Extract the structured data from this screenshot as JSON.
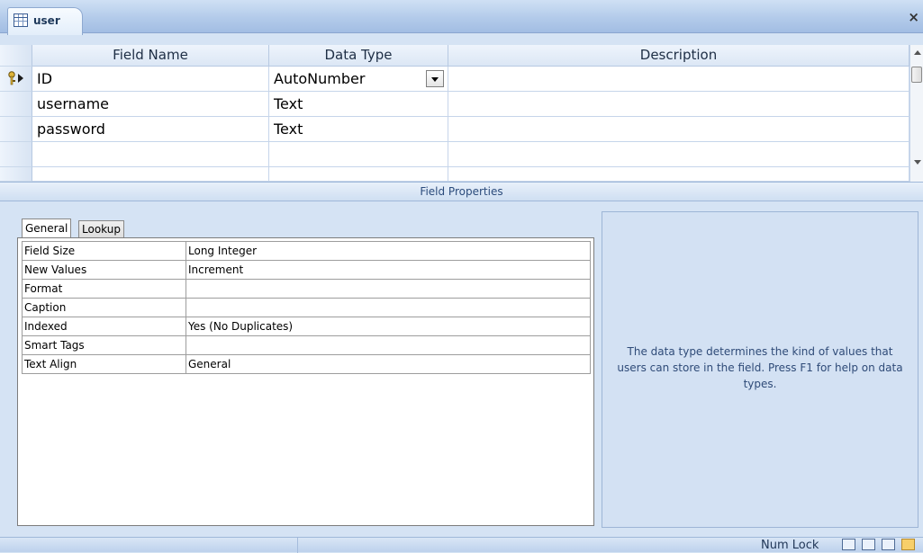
{
  "document_tab": {
    "label": "user",
    "close_glyph": "×",
    "icon": "table-icon"
  },
  "field_grid": {
    "headers": [
      "Field Name",
      "Data Type",
      "Description"
    ],
    "rows": [
      {
        "field_name": "ID",
        "data_type": "AutoNumber",
        "description": "",
        "primary_key": true,
        "selected": true
      },
      {
        "field_name": "username",
        "data_type": "Text",
        "description": ""
      },
      {
        "field_name": "password",
        "data_type": "Text",
        "description": ""
      },
      {
        "field_name": "",
        "data_type": "",
        "description": ""
      },
      {
        "field_name": "",
        "data_type": "",
        "description": ""
      }
    ]
  },
  "field_properties": {
    "title": "Field Properties",
    "tabs": [
      {
        "label": "General",
        "active": true
      },
      {
        "label": "Lookup",
        "active": false
      }
    ],
    "properties": [
      {
        "name": "Field Size",
        "value": "Long Integer"
      },
      {
        "name": "New Values",
        "value": "Increment"
      },
      {
        "name": "Format",
        "value": ""
      },
      {
        "name": "Caption",
        "value": ""
      },
      {
        "name": "Indexed",
        "value": "Yes (No Duplicates)"
      },
      {
        "name": "Smart Tags",
        "value": ""
      },
      {
        "name": "Text Align",
        "value": "General"
      }
    ],
    "help_text": "The data type determines the kind of values that users can store in the field.  Press F1 for help on data types."
  },
  "status_bar": {
    "num_lock": "Num Lock",
    "view_buttons": [
      "datasheet-view-icon",
      "pivottable-view-icon",
      "pivotchart-view-icon",
      "design-view-icon"
    ]
  },
  "colors": {
    "accent": "#a2bde3",
    "help_text": "#2f4b78",
    "panel_bg": "#d5e3f4"
  }
}
